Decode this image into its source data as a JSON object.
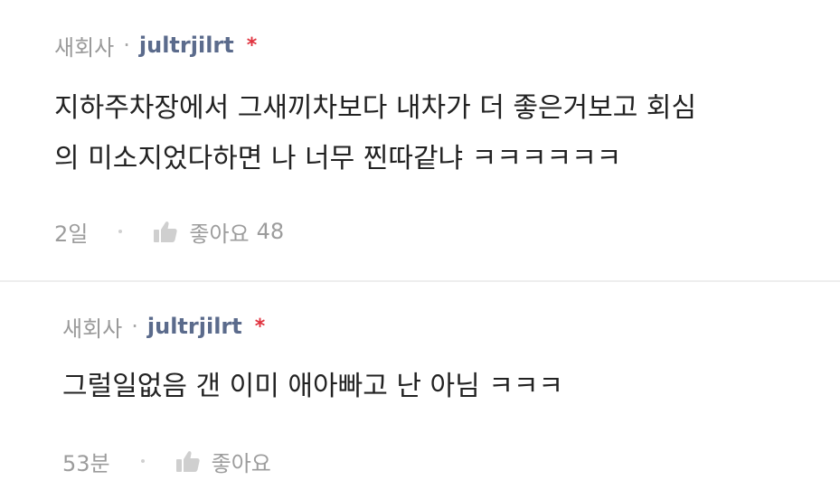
{
  "comments": [
    {
      "nickname": "새회사",
      "separator": "·",
      "username": "jultrjilrt",
      "badge": "*",
      "lines": [
        "지하주차장에서 그새끼차보다 내차가 더 좋은거보고 회심",
        "의 미소지었다하면 나 너무 찐따같냐 ㅋㅋㅋㅋㅋㅋ"
      ],
      "time": "2일",
      "like_label": "좋아요",
      "like_count": "48"
    },
    {
      "nickname": "새회사",
      "separator": "·",
      "username": "jultrjilrt",
      "badge": "*",
      "lines": [
        "그럴일없음 갠 이미 애아빠고 난 아님 ㅋㅋㅋ"
      ],
      "time": "53분",
      "like_label": "좋아요",
      "like_count": ""
    }
  ],
  "colors": {
    "username": "#5b6b8c",
    "badge": "#e0323e",
    "meta": "#9a9a9a",
    "body": "#222222"
  },
  "icons": {
    "like": "thumbs-up-icon"
  }
}
